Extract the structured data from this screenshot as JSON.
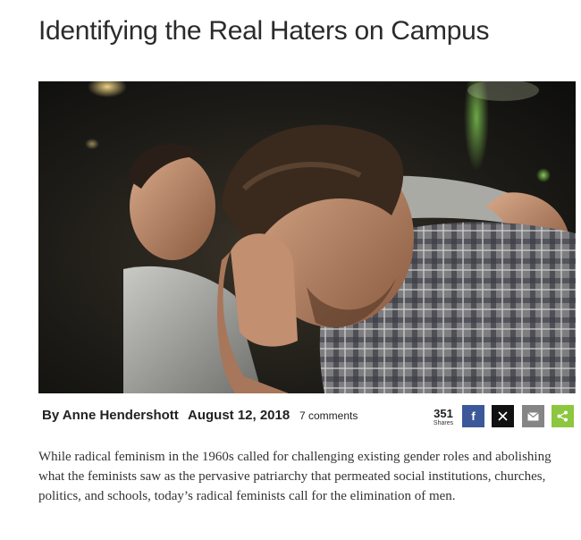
{
  "article": {
    "title": "Identifying the Real Haters on Campus",
    "hero_image_alt": "Man comforting another man with head in hand",
    "byline": "By Anne Hendershott",
    "date": "August 12, 2018",
    "comments": "7 comments",
    "share_count": "351",
    "share_label": "Shares",
    "body": "While radical feminism in the 1960s called for challenging existing gender roles and abolishing what the feminists saw as the pervasive patriarchy that permeated social institutions, churches, politics, and schools, today’s radical feminists call for the elimination of men."
  },
  "share_buttons": [
    {
      "name": "facebook",
      "icon": "facebook-icon",
      "color": "#3b5998"
    },
    {
      "name": "x",
      "icon": "x-icon",
      "color": "#111111"
    },
    {
      "name": "email",
      "icon": "mail-icon",
      "color": "#858585"
    },
    {
      "name": "share",
      "icon": "share-icon",
      "color": "#8dc63f"
    }
  ]
}
